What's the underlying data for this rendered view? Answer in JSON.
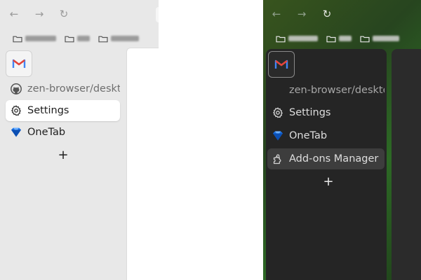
{
  "left_window": {
    "nav": {
      "back_icon": "←",
      "forward_icon": "→",
      "reload_icon": "↻"
    },
    "bookmarks": [
      "folder",
      "folder",
      "folder"
    ],
    "sidebar": {
      "essential_icon": "gmail-icon",
      "items": [
        {
          "label": "zen-browser/deskto",
          "icon": "github-icon",
          "selected": false
        },
        {
          "label": "Settings",
          "icon": "gear-icon",
          "selected": true
        },
        {
          "label": "OneTab",
          "icon": "onetab-icon",
          "selected": false
        }
      ],
      "new_tab": "+"
    }
  },
  "right_window": {
    "nav": {
      "back_icon": "←",
      "forward_icon": "→",
      "reload_icon": "↻"
    },
    "bookmarks": [
      "folder",
      "folder",
      "folder"
    ],
    "sidebar": {
      "essential_icon": "gmail-icon",
      "items": [
        {
          "label": "zen-browser/deskto",
          "icon": "none",
          "selected": false
        },
        {
          "label": "Settings",
          "icon": "gear-icon",
          "selected": false
        },
        {
          "label": "OneTab",
          "icon": "onetab-icon",
          "selected": false
        },
        {
          "label": "Add-ons Manager",
          "icon": "puzzle-icon",
          "selected": true
        }
      ],
      "new_tab": "+"
    }
  },
  "colors": {
    "light_sidebar": "#e8e8e8",
    "dark_sidebar": "#252525",
    "dark_accent_green": "#2d6a25",
    "gmail_blue": "#4285f4",
    "gmail_red": "#ea4335",
    "onetab_blue": "#1a73e8"
  }
}
